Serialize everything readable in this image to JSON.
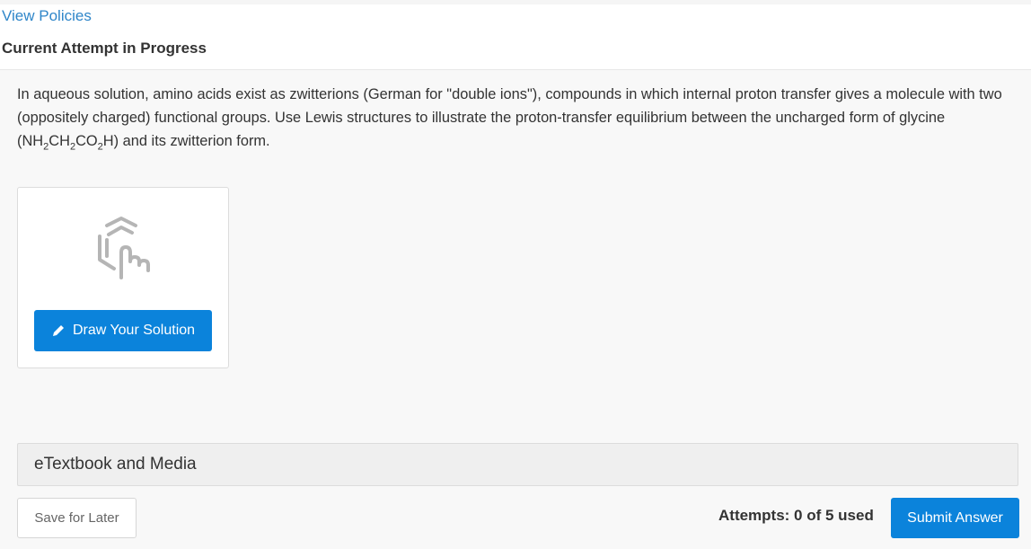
{
  "header": {
    "link_label": "View Policies",
    "title": "Current Attempt in Progress"
  },
  "question": {
    "part1": "In aqueous solution, amino acids exist as zwitterions (German for \"double ions\"), compounds in which internal proton transfer gives a molecule with two (oppositely charged) functional groups. Use Lewis structures to illustrate the proton-transfer equilibrium between the uncharged form of glycine (NH",
    "sub1": "2",
    "part2": "CH",
    "sub2": "2",
    "part3": "CO",
    "sub3": "2",
    "part4": "H) and its zwitterion form."
  },
  "draw_card": {
    "icon": "molecule-pointer-icon",
    "button_icon": "pencil-icon",
    "button_label": "Draw Your Solution"
  },
  "resources": {
    "label": "eTextbook and Media"
  },
  "footer": {
    "save_label": "Save for Later",
    "attempts_text": "Attempts: 0 of 5 used",
    "submit_label": "Submit Answer"
  },
  "colors": {
    "link": "#2f86c9",
    "primary_button": "#0b83db",
    "panel_background": "#f8f8f8"
  }
}
